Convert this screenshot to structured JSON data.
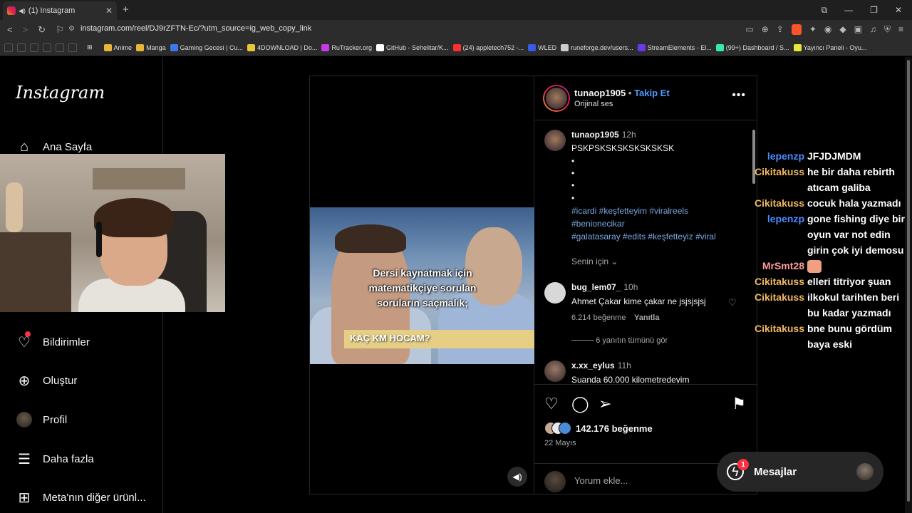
{
  "browser": {
    "tab_title": "(1) Instagram",
    "url": "instagram.com/reel/DJ9rZFTN-Ec/?utm_source=ig_web_copy_link",
    "bookmarks": [
      {
        "label": "Anime",
        "color": "#e8b53a"
      },
      {
        "label": "Manga",
        "color": "#e8b53a"
      },
      {
        "label": "Gaming Gecesi | Cu...",
        "color": "#3a7be8"
      },
      {
        "label": "4DOWNLOAD | Do...",
        "color": "#e8c83a"
      },
      {
        "label": "RuTracker.org",
        "color": "#c83ae8"
      },
      {
        "label": "GitHub - Sehelitar/K...",
        "color": "#ffffff"
      },
      {
        "label": "(24) appletech752 -...",
        "color": "#ff3030"
      },
      {
        "label": "WLED",
        "color": "#3a5ae8"
      },
      {
        "label": "runeforge.dev/users...",
        "color": "#cccccc"
      },
      {
        "label": "StreamElements - El...",
        "color": "#6a3ae8"
      },
      {
        "label": "(99+) Dashboard / S...",
        "color": "#3ae8a8"
      },
      {
        "label": "Yayıncı Paneli - Oyu...",
        "color": "#e8e83a"
      }
    ]
  },
  "sidebar": {
    "logo": "Instagram",
    "items": [
      {
        "label": "Ana Sayfa",
        "icon": "home-icon"
      },
      {
        "label": "Bildirimler",
        "icon": "heart-icon"
      },
      {
        "label": "Oluştur",
        "icon": "plus-square-icon"
      },
      {
        "label": "Profil",
        "icon": "avatar"
      },
      {
        "label": "Daha fazla",
        "icon": "menu-icon"
      },
      {
        "label": "Meta'nın diğer ürünl...",
        "icon": "grid-icon"
      }
    ]
  },
  "reel": {
    "subtitle_lines": [
      "Dersi kaynatmak için",
      "matematikçiye sorulan",
      "soruların saçmalık;"
    ],
    "banner": "KAÇ KM HOCAM?"
  },
  "post": {
    "username": "tunaop1905",
    "follow_label": "Takip Et",
    "separator": "•",
    "audio": "Orijinal ses",
    "caption": {
      "username": "tunaop1905",
      "time": "12h",
      "text": "PSKPSKSKSKSKSKSKSK",
      "bullets": [
        "•",
        "•",
        "•",
        "•"
      ],
      "hashtags": [
        "#icardi #keşfetteyim #viralreels",
        "#benionecikar",
        "#galatasaray #edits #keşfetteyiz #viral"
      ]
    },
    "for_you": "Senin için",
    "comments": [
      {
        "username": "bug_lem07_",
        "time": "10h",
        "text": "Ahmet Çakar kime çakar ne jsjsjsjsj",
        "likes": "6.214 beğenme",
        "reply": "Yanıtla",
        "view_replies": "6 yanıtın tümünü gör"
      },
      {
        "username": "x.xx_eylus",
        "time": "11h",
        "text": "Suanda 60.000 kilometredeyim"
      }
    ],
    "likes": "142.176 beğenme",
    "date": "22 Mayıs",
    "add_comment_placeholder": "Yorum ekle..."
  },
  "chat": [
    {
      "user": "lepenzp",
      "text": "JFJDJMDM",
      "color": "#4a8bff"
    },
    {
      "user": "Cikitakuss",
      "text": "he bir daha rebirth atıcam galiba",
      "color": "#f0b860"
    },
    {
      "user": "Cikitakuss",
      "text": "cocuk hala yazmadı",
      "color": "#f0b860"
    },
    {
      "user": "lepenzp",
      "text": "gone fishing diye bir oyun var not edin girin çok iyi demosu",
      "color": "#4a8bff"
    },
    {
      "user": "MrSmt28",
      "text": "",
      "color": "#ff9aa0",
      "emote": true
    },
    {
      "user": "Cikitakuss",
      "text": "elleri titriyor şuan",
      "color": "#f0b860"
    },
    {
      "user": "Cikitakuss",
      "text": "ilkokul tarihten beri bu kadar yazmadı",
      "color": "#f0b860"
    },
    {
      "user": "Cikitakuss",
      "text": "bne bunu gördüm baya eski",
      "color": "#f0b860"
    }
  ],
  "messages": {
    "label": "Mesajlar",
    "badge": "1"
  }
}
